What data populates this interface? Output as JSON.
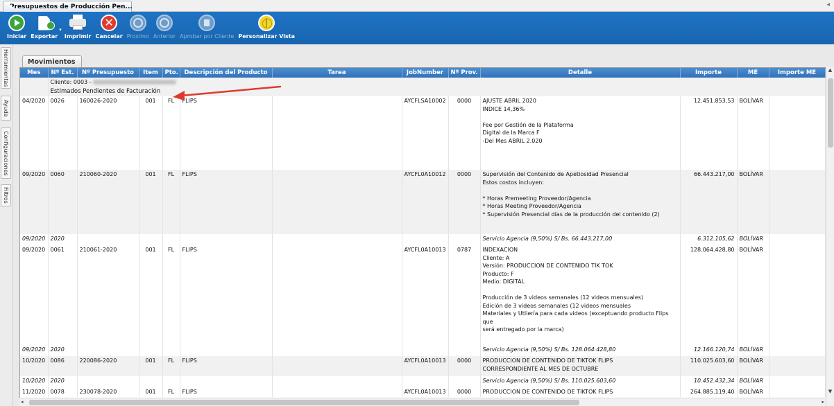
{
  "window": {
    "tab_title": "Presupuestos de Producción Pen...",
    "tab_scroll_glyph": "◂",
    "accent": "#1a6bb8"
  },
  "toolbar": {
    "buttons": [
      {
        "label": "Iniciar",
        "icon": "play-icon",
        "enabled": true
      },
      {
        "label": "Exportar",
        "icon": "export-icon",
        "enabled": true
      },
      {
        "label": "Imprimir",
        "icon": "printer-icon",
        "enabled": true
      },
      {
        "label": "Cancelar",
        "icon": "cancel-icon",
        "enabled": true
      },
      {
        "label": "Proximo",
        "icon": "next-icon",
        "enabled": false
      },
      {
        "label": "Anterior",
        "icon": "previous-icon",
        "enabled": false
      },
      {
        "label": "Aprobar por Cliente",
        "icon": "approve-icon",
        "enabled": false
      },
      {
        "label": "Personalizar Vista",
        "icon": "globe-icon",
        "enabled": true
      }
    ],
    "export_caret": "▾"
  },
  "side_tabs": [
    "Herramientas",
    "Ayuda",
    "Configuraciones",
    "Filtros"
  ],
  "panel": {
    "tab_label": "Movimientos"
  },
  "grid": {
    "columns": [
      "Mes",
      "Nº Est.",
      "Nº Presupuesto",
      "Item",
      "Pto.",
      "Descripción del Producto",
      "Tarea",
      "JobNumber",
      "Nº Prov.",
      "Detalle",
      "Importe",
      "ME",
      "Importe ME"
    ],
    "group_client": "Cliente: 0003 - ",
    "group_subtitle": "Estimados Pendientes de Facturación",
    "rows": [
      {
        "mes": "04/2020",
        "est": "0026",
        "pres": "160026-2020",
        "item": "001",
        "pto": "FL",
        "desc": "FLIPS",
        "tarea": "",
        "job": "AYCFLSA10002",
        "prov": "0000",
        "detalle": "AJUSTE ABRIL 2020\nINDICE 14,36%\n\nFee por Gestión de la Plataforma\nDigital de la Marca F\n-Del Mes ABRIL  2.020",
        "importe": "12.451.853,53",
        "me": "BOLÍVAR",
        "importe_me": ""
      },
      {
        "mes": "09/2020",
        "est": "0060",
        "pres": "210060-2020",
        "item": "001",
        "pto": "FL",
        "desc": "FLIPS",
        "tarea": "",
        "job": "AYCFL0A10012",
        "prov": "0000",
        "detalle": "Supervisión del Contenido de Apetiosidad Presencial\nEstos costos incluyen:\n\n* Horas Premeeting Proveedor/Agencia\n* Horas Meeting Proveedor/Agencia\n* Supervisión Presencial días de la producción  del contenido (2)",
        "importe": "66.443.217,00",
        "me": "BOLÍVAR",
        "importe_me": ""
      },
      {
        "mes": "09/2020",
        "est": "2020",
        "pres": "",
        "item": "",
        "pto": "",
        "desc": "",
        "tarea": "",
        "job": "",
        "prov": "",
        "detalle": "Servicio Agencia (9,50%) S/ Bs. 66.443.217,00",
        "importe": "6.312.105,62",
        "me": "BOLÍVAR",
        "importe_me": "",
        "italic": true
      },
      {
        "mes": "09/2020",
        "est": "0061",
        "pres": "210061-2020",
        "item": "001",
        "pto": "FL",
        "desc": "FLIPS",
        "tarea": "",
        "job": "AYCFL0A10013",
        "prov": "0787",
        "detalle": "INDEXACION\nCliente: A\nVersión:    PRODUCCION DE CONTENIDO TIK TOK\nProducto: F\nMedio: DIGITAL\n\nProducción de 3 videos semanales (12 videos mensuales)\nEdición de 3 videos semanales (12 videos mensuales\nMateriales y Utliería para cada videos (exceptuando producto Flips que\nserá entregado por la marca)",
        "importe": "128.064.428,80",
        "me": "BOLÍVAR",
        "importe_me": ""
      },
      {
        "mes": "09/2020",
        "est": "2020",
        "pres": "",
        "item": "",
        "pto": "",
        "desc": "",
        "tarea": "",
        "job": "",
        "prov": "",
        "detalle": "Servicio Agencia (9,50%) S/ Bs. 128.064.428,80",
        "importe": "12.166.120,74",
        "me": "BOLÍVAR",
        "importe_me": "",
        "italic": true
      },
      {
        "mes": "10/2020",
        "est": "0086",
        "pres": "220086-2020",
        "item": "001",
        "pto": "FL",
        "desc": "FLIPS",
        "tarea": "",
        "job": "AYCFL0A10013",
        "prov": "0000",
        "detalle": "PRODUCCION DE CONTENIDO DE TIKTOK FLIPS\nCORRESPONDIENTE AL MES DE OCTUBRE",
        "importe": "110.025.603,60",
        "me": "BOLÍVAR",
        "importe_me": ""
      },
      {
        "mes": "10/2020",
        "est": "2020",
        "pres": "",
        "item": "",
        "pto": "",
        "desc": "",
        "tarea": "",
        "job": "",
        "prov": "",
        "detalle": "Servicio Agencia (9,50%) S/ Bs. 110.025.603,60",
        "importe": "10.452.432,34",
        "me": "BOLÍVAR",
        "importe_me": "",
        "italic": true
      },
      {
        "mes": "11/2020",
        "est": "0078",
        "pres": "230078-2020",
        "item": "001",
        "pto": "FL",
        "desc": "FLIPS",
        "tarea": "",
        "job": "AYCFL0A10013",
        "prov": "0000",
        "detalle": "PRODUCCION DE CONTENIDO DE TIKTOK FLIPS",
        "importe": "264.885.119,40",
        "me": "BOLÍVAR",
        "importe_me": ""
      }
    ]
  },
  "annotation": {
    "color": "#e0392b"
  }
}
